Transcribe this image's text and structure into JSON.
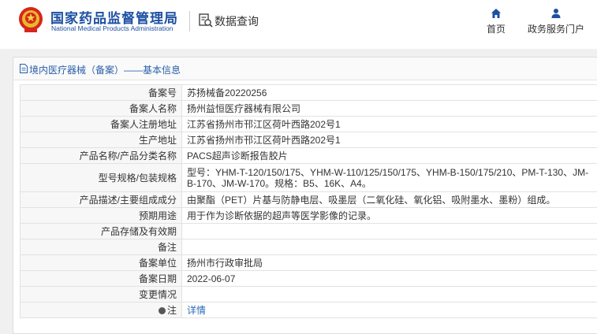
{
  "header": {
    "logo_cn": "国家药品监督管理局",
    "logo_en": "National Medical Products Administration",
    "section_label": "数据查询",
    "nav": [
      {
        "label": "首页",
        "icon": "home-icon"
      },
      {
        "label": "政务服务门户",
        "icon": "user-icon"
      }
    ]
  },
  "panel": {
    "title": "境内医疗器械（备案）——基本信息"
  },
  "rows": [
    {
      "key": "备案号",
      "value": "苏扬械备20220256"
    },
    {
      "key": "备案人名称",
      "value": "扬州益恒医疗器械有限公司"
    },
    {
      "key": "备案人注册地址",
      "value": "江苏省扬州市邗江区荷叶西路202号1"
    },
    {
      "key": "生产地址",
      "value": "江苏省扬州市邗江区荷叶西路202号1"
    },
    {
      "key": "产品名称/产品分类名称",
      "value": "PACS超声诊断报告胶片"
    },
    {
      "key": "型号规格/包装规格",
      "value": "型号：YHM-T-120/150/175、YHM-W-110/125/150/175、YHM-B-150/175/210、PM-T-130、JM-B-170、JM-W-170。规格：B5、16K、A4。"
    },
    {
      "key": "产品描述/主要组成成分",
      "value": "由聚酯（PET）片基与防静电层、吸墨层（二氧化硅、氧化铝、吸附墨水、墨粉）组成。"
    },
    {
      "key": "预期用途",
      "value": "用于作为诊断依据的超声等医学影像的记录。"
    },
    {
      "key": "产品存储及有效期",
      "value": ""
    },
    {
      "key": "备注",
      "value": ""
    },
    {
      "key": "备案单位",
      "value": "扬州市行政审批局"
    },
    {
      "key": "备案日期",
      "value": "2022-06-07"
    },
    {
      "key": "变更情况",
      "value": ""
    },
    {
      "key": "注",
      "value": "详情"
    }
  ]
}
